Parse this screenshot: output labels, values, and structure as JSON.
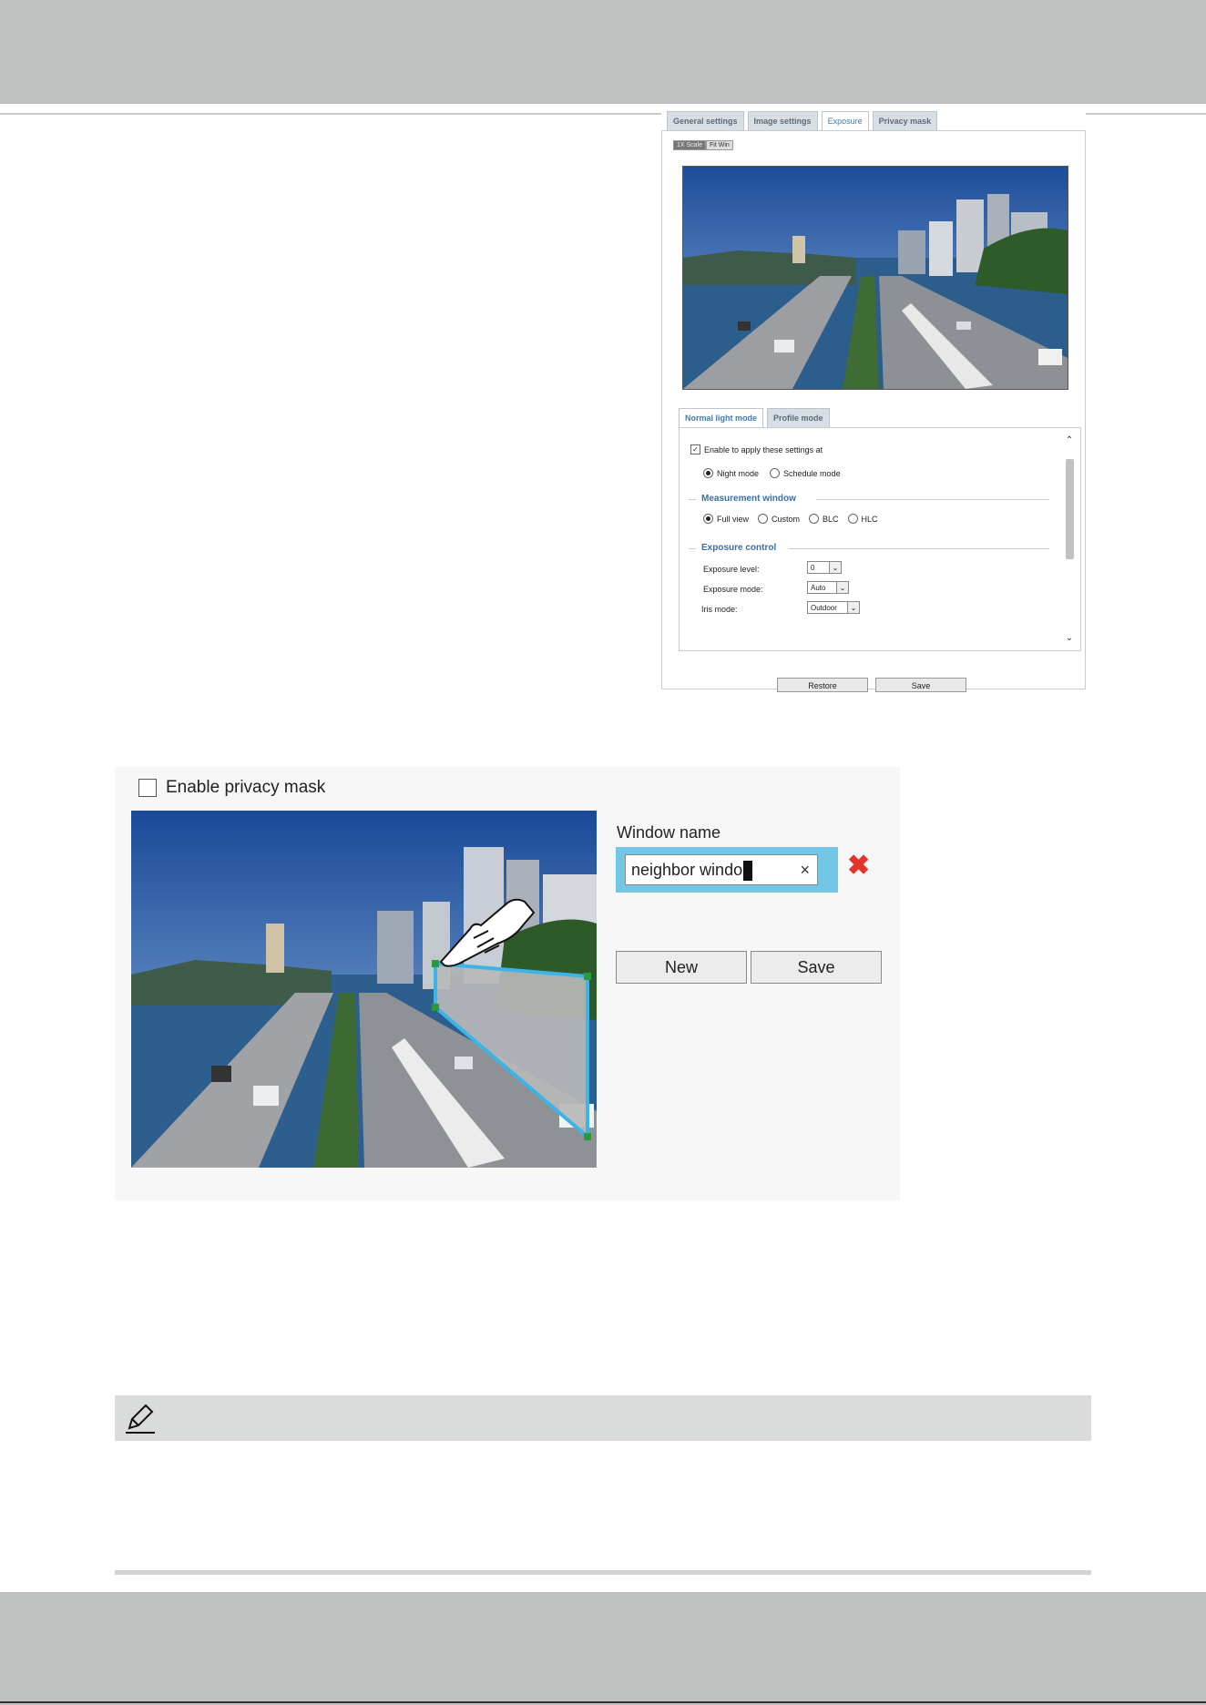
{
  "top_screenshot": {
    "tabs": [
      "General settings",
      "Image settings",
      "Exposure",
      "Privacy mask"
    ],
    "active_tab": "Exposure",
    "zoom_buttons": [
      "1X Scale",
      "Fit Win"
    ],
    "mode_tabs": [
      "Normal light mode",
      "Profile mode"
    ],
    "enable_label": "Enable to apply these settings at",
    "enable_checked": true,
    "schedule_options": [
      "Night mode",
      "Schedule mode"
    ],
    "schedule_selected": "Night mode",
    "measurement_title": "Measurement window",
    "measurement_options": [
      "Full view",
      "Custom",
      "BLC",
      "HLC"
    ],
    "measurement_selected": "Full view",
    "exposure_title": "Exposure control",
    "exposure_level_label": "Exposure level:",
    "exposure_level_value": "0",
    "exposure_mode_label": "Exposure mode:",
    "exposure_mode_value": "Auto",
    "iris_mode_label": "Iris mode:",
    "iris_mode_value": "Outdoor",
    "restore_label": "Restore",
    "save_label": "Save"
  },
  "bottom_screenshot": {
    "enable_label": "Enable privacy mask",
    "enable_checked": false,
    "window_name_label": "Window name",
    "window_name_value": "neighbor windo",
    "clear_symbol": "×",
    "delete_symbol": "✖",
    "new_label": "New",
    "save_label": "Save",
    "mask_color": "#73c6e4"
  },
  "icons": [
    "pencil-note-icon",
    "pointing-hand-icon"
  ]
}
